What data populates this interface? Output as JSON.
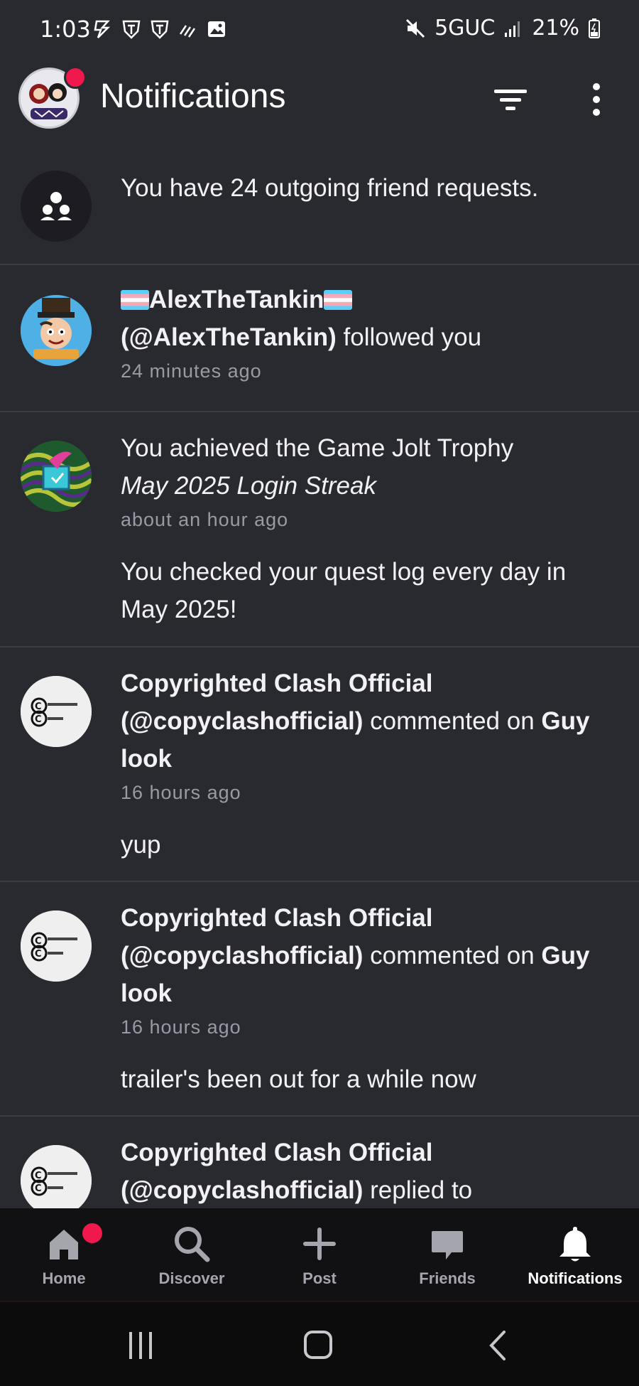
{
  "status_bar": {
    "time": "1:03",
    "network": "5GUC",
    "battery": "21%",
    "icons": [
      "flash-icon",
      "transformers-icon",
      "transformers-icon",
      "signal-wave-icon",
      "gallery-icon",
      "mute-icon",
      "signal-bars-icon",
      "battery-icon"
    ]
  },
  "header": {
    "title": "Notifications",
    "filter_icon": "filter-icon",
    "more_icon": "more-vertical-icon"
  },
  "notifications": [
    {
      "type": "friend_requests",
      "text": "You have 24 outgoing friend requests."
    },
    {
      "type": "follow",
      "display_name": "🏳️‍⚧️AlexTheTankin🏳️‍⚧️",
      "display_name_text": "AlexTheTankin",
      "handle": "(@AlexTheTankin)",
      "action": "followed you",
      "time": "24 minutes ago"
    },
    {
      "type": "trophy",
      "text_prefix": "You achieved the Game Jolt Trophy",
      "trophy_name": "May 2025 Login Streak",
      "time": "about an hour ago",
      "body": "You checked your quest log every day in May 2025!"
    },
    {
      "type": "comment",
      "display_name": "Copyrighted Clash Official",
      "handle": "(@copyclashofficial)",
      "action": "commented on",
      "target": "Guy look",
      "time": "16 hours ago",
      "body": "yup"
    },
    {
      "type": "comment",
      "display_name": "Copyrighted Clash Official",
      "handle": "(@copyclashofficial)",
      "action": "commented on",
      "target": "Guy look",
      "time": "16 hours ago",
      "body": "trailer's been out for a while now"
    },
    {
      "type": "reply",
      "display_name": "Copyrighted Clash Official",
      "handle": "(@copyclashofficial)",
      "action": "replied to"
    }
  ],
  "bottom_nav": [
    {
      "label": "Home",
      "icon": "home-icon",
      "badge": true,
      "active": false
    },
    {
      "label": "Discover",
      "icon": "search-icon",
      "active": false
    },
    {
      "label": "Post",
      "icon": "plus-icon",
      "active": false
    },
    {
      "label": "Friends",
      "icon": "chat-icon",
      "active": false
    },
    {
      "label": "Notifications",
      "icon": "bell-icon",
      "active": true
    }
  ],
  "colors": {
    "background": "#292930",
    "badge": "#f1184d",
    "nav_background": "#111113",
    "secondary_text": "#9a9aa6"
  }
}
